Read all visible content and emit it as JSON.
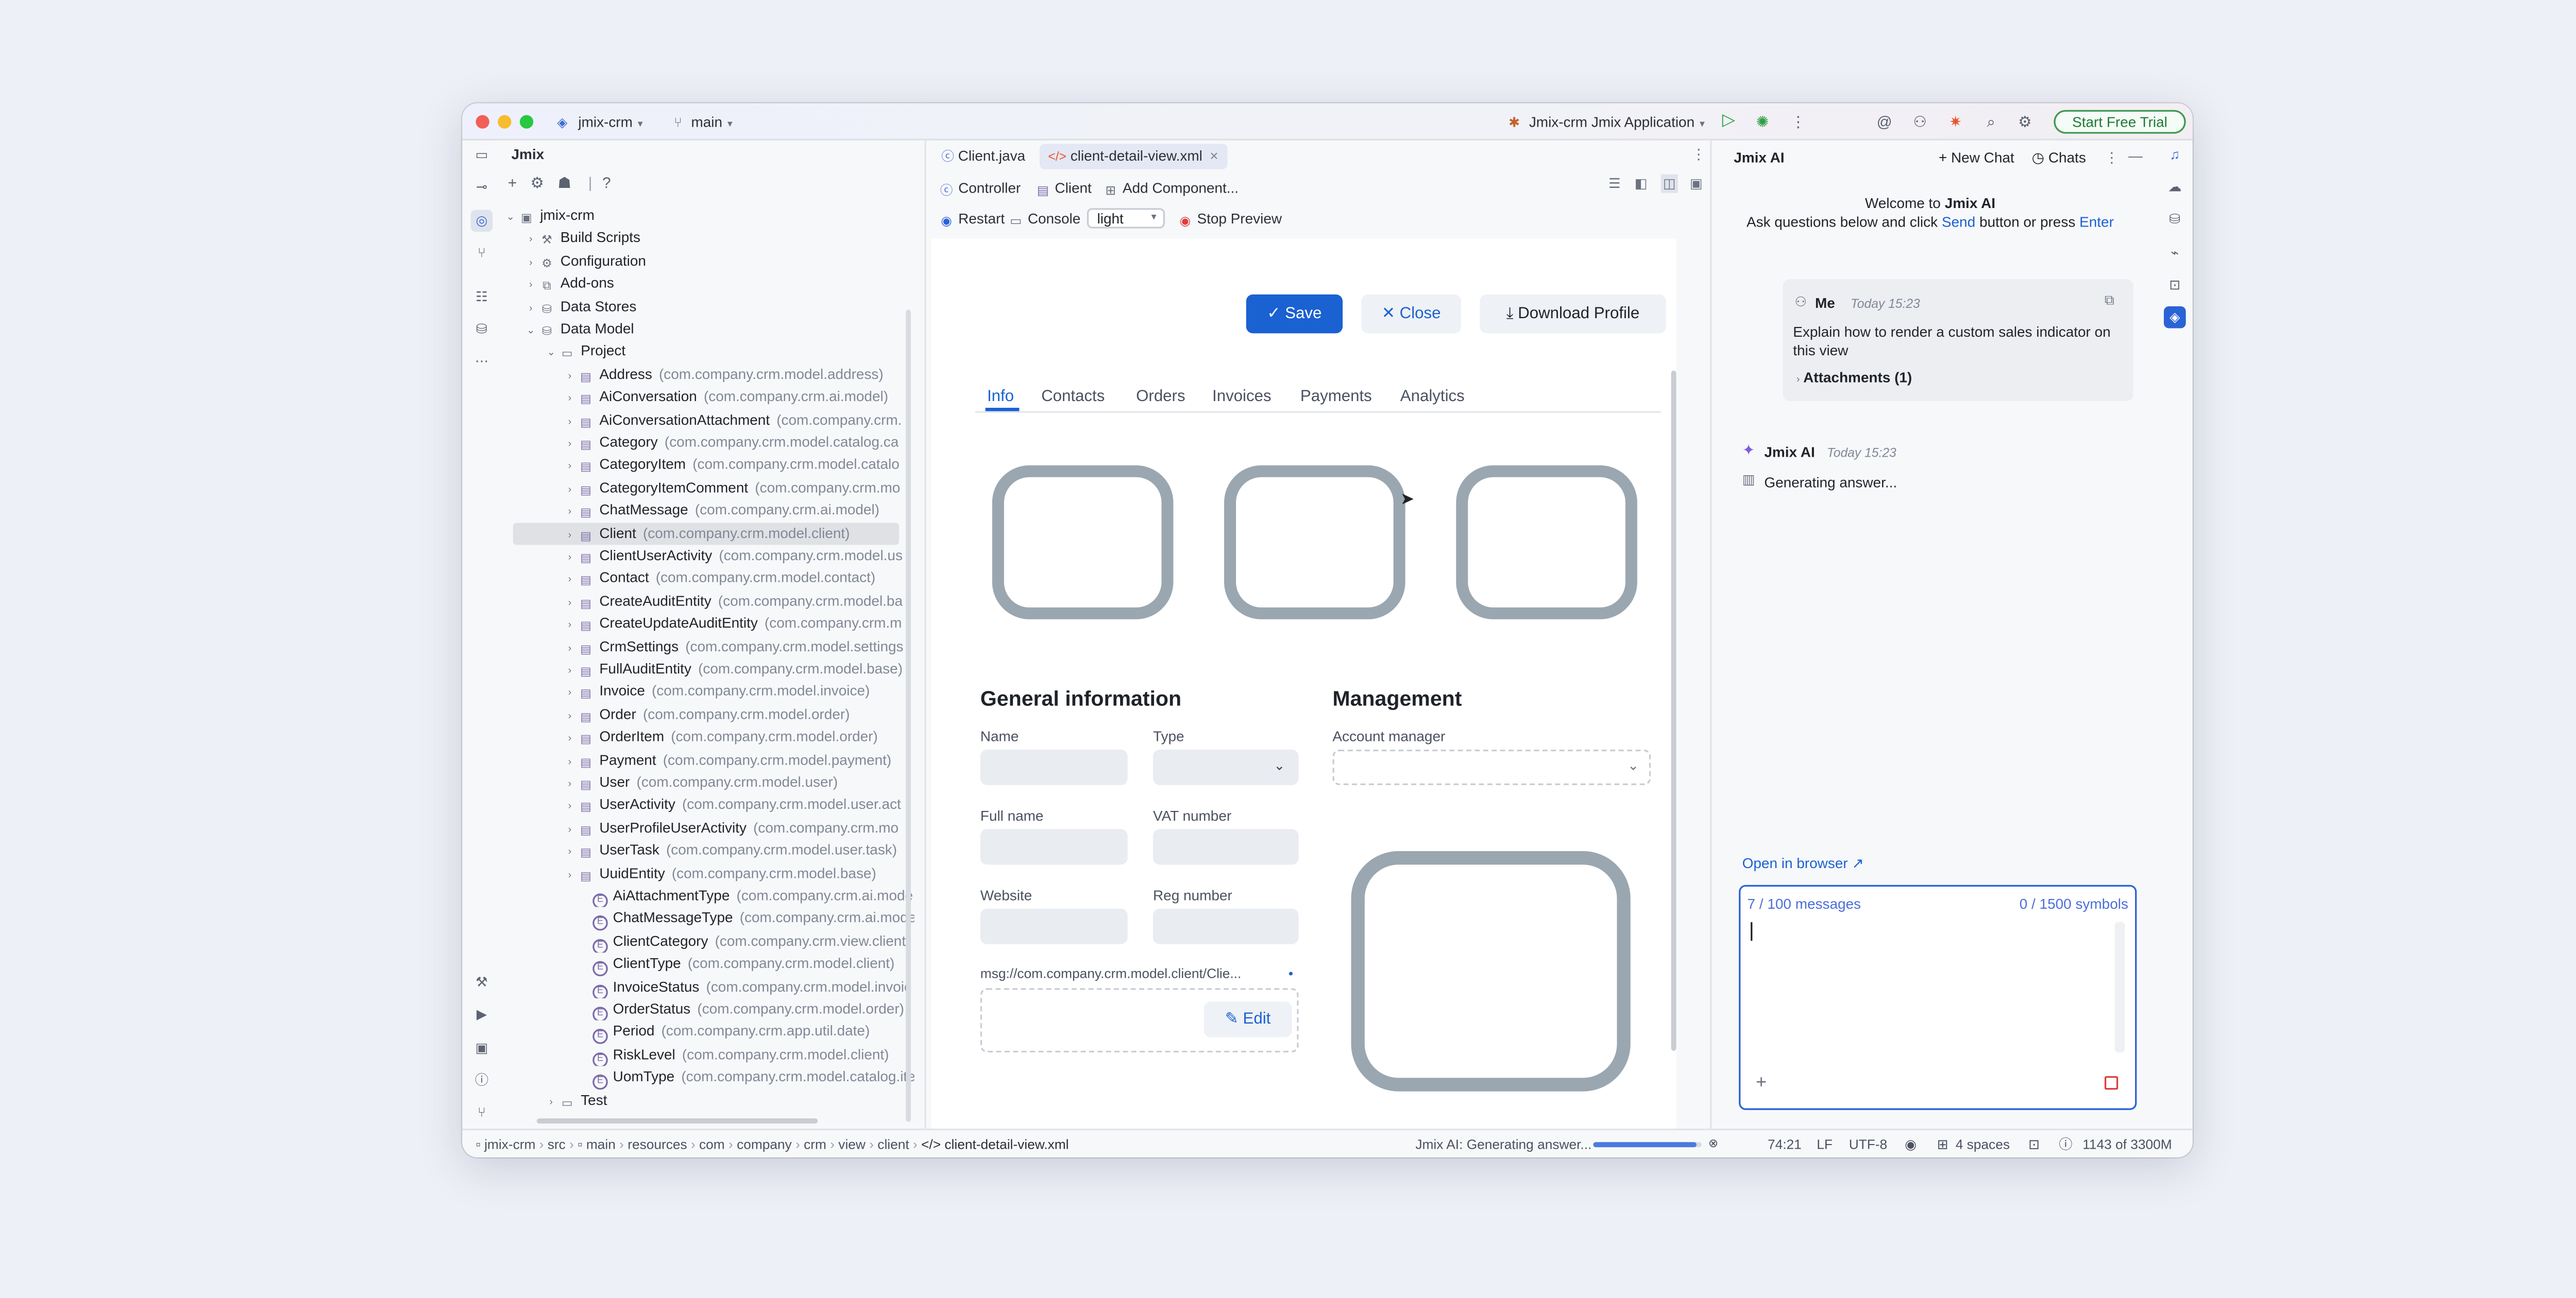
{
  "titlebar": {
    "project": "jmix-crm",
    "branch": "main",
    "run_config": "Jmix-crm Jmix Application",
    "trial_button": "Start Free Trial",
    "icons": [
      "run-icon",
      "debug-icon",
      "more-icon",
      "ai-assistant-icon",
      "account-icon",
      "jmix-icon",
      "search-icon",
      "settings-icon"
    ]
  },
  "project_panel": {
    "title": "Jmix",
    "root": "jmix-crm",
    "folders": [
      "Build Scripts",
      "Configuration",
      "Add-ons",
      "Data Stores",
      "Data Model"
    ],
    "project_folder": "Project",
    "entities": [
      {
        "name": "Address",
        "pkg": "(com.company.crm.model.address)"
      },
      {
        "name": "AiConversation",
        "pkg": "(com.company.crm.ai.model)"
      },
      {
        "name": "AiConversationAttachment",
        "pkg": "(com.company.crm."
      },
      {
        "name": "Category",
        "pkg": "(com.company.crm.model.catalog.ca"
      },
      {
        "name": "CategoryItem",
        "pkg": "(com.company.crm.model.catalo"
      },
      {
        "name": "CategoryItemComment",
        "pkg": "(com.company.crm.mo"
      },
      {
        "name": "ChatMessage",
        "pkg": "(com.company.crm.ai.model)"
      },
      {
        "name": "Client",
        "pkg": "(com.company.crm.model.client)"
      },
      {
        "name": "ClientUserActivity",
        "pkg": "(com.company.crm.model.us"
      },
      {
        "name": "Contact",
        "pkg": "(com.company.crm.model.contact)"
      },
      {
        "name": "CreateAuditEntity",
        "pkg": "(com.company.crm.model.ba"
      },
      {
        "name": "CreateUpdateAuditEntity",
        "pkg": "(com.company.crm.m"
      },
      {
        "name": "CrmSettings",
        "pkg": "(com.company.crm.model.settings"
      },
      {
        "name": "FullAuditEntity",
        "pkg": "(com.company.crm.model.base)"
      },
      {
        "name": "Invoice",
        "pkg": "(com.company.crm.model.invoice)"
      },
      {
        "name": "Order",
        "pkg": "(com.company.crm.model.order)"
      },
      {
        "name": "OrderItem",
        "pkg": "(com.company.crm.model.order)"
      },
      {
        "name": "Payment",
        "pkg": "(com.company.crm.model.payment)"
      },
      {
        "name": "User",
        "pkg": "(com.company.crm.model.user)"
      },
      {
        "name": "UserActivity",
        "pkg": "(com.company.crm.model.user.act"
      },
      {
        "name": "UserProfileUserActivity",
        "pkg": "(com.company.crm.mo"
      },
      {
        "name": "UserTask",
        "pkg": "(com.company.crm.model.user.task)"
      },
      {
        "name": "UuidEntity",
        "pkg": "(com.company.crm.model.base)"
      }
    ],
    "enums": [
      {
        "name": "AiAttachmentType",
        "pkg": "(com.company.crm.ai.mode"
      },
      {
        "name": "ChatMessageType",
        "pkg": "(com.company.crm.ai.mode"
      },
      {
        "name": "ClientCategory",
        "pkg": "(com.company.crm.view.client)"
      },
      {
        "name": "ClientType",
        "pkg": "(com.company.crm.model.client)"
      },
      {
        "name": "InvoiceStatus",
        "pkg": "(com.company.crm.model.invoic"
      },
      {
        "name": "OrderStatus",
        "pkg": "(com.company.crm.model.order)"
      },
      {
        "name": "Period",
        "pkg": "(com.company.crm.app.util.date)"
      },
      {
        "name": "RiskLevel",
        "pkg": "(com.company.crm.model.client)"
      },
      {
        "name": "UomType",
        "pkg": "(com.company.crm.model.catalog.ite"
      }
    ],
    "test_folder": "Test",
    "selected": "Client"
  },
  "editor": {
    "tabs": [
      "Client.java",
      "client-detail-view.xml"
    ],
    "toolbar": {
      "controller": "Controller",
      "entity": "Client",
      "add_component": "Add Component...",
      "restart": "Restart",
      "console": "Console",
      "theme": "light",
      "stop_preview": "Stop Preview"
    },
    "preview": {
      "save": "Save",
      "close": "Close",
      "download": "Download Profile",
      "tabs": [
        "Info",
        "Contacts",
        "Orders",
        "Invoices",
        "Payments",
        "Analytics"
      ],
      "active_tab": "Info",
      "general_title": "General information",
      "management_title": "Management",
      "labels": {
        "name": "Name",
        "type": "Type",
        "full_name": "Full name",
        "vat": "VAT number",
        "website": "Website",
        "reg": "Reg number",
        "account_manager": "Account manager"
      },
      "msg_key": "msg://com.company.crm.model.client/Clie...",
      "edit": "Edit"
    }
  },
  "ai_panel": {
    "title": "Jmix AI",
    "new_chat": "New Chat",
    "chats": "Chats",
    "welcome": "Welcome to",
    "welcome_brand": "Jmix AI",
    "instructions_pre": "Ask questions below and click",
    "send": "Send",
    "instructions_mid": "button or press",
    "enter": "Enter",
    "me_name": "Me",
    "me_time": "Today 15:23",
    "me_text": "Explain how to render a custom sales indicator on this view",
    "attachments": "Attachments (1)",
    "ai_name": "Jmix AI",
    "ai_time": "Today 15:23",
    "ai_text": "Generating answer...",
    "open_browser": "Open in browser ↗",
    "messages_count": "7 / 100 messages",
    "symbols_count": "0 / 1500 symbols"
  },
  "statusbar": {
    "breadcrumb": [
      "jmix-crm",
      "src",
      "main",
      "resources",
      "com",
      "company",
      "crm",
      "view",
      "client",
      "client-detail-view.xml"
    ],
    "ai_status": "Jmix AI: Generating answer...",
    "position": "74:21",
    "line_sep": "LF",
    "encoding": "UTF-8",
    "indent": "4 spaces",
    "memory": "1143 of 3300M"
  },
  "colors": {
    "accent": "#1a61d2",
    "trial_green": "#3d9a50",
    "placeholder": "#9aa7b0"
  }
}
